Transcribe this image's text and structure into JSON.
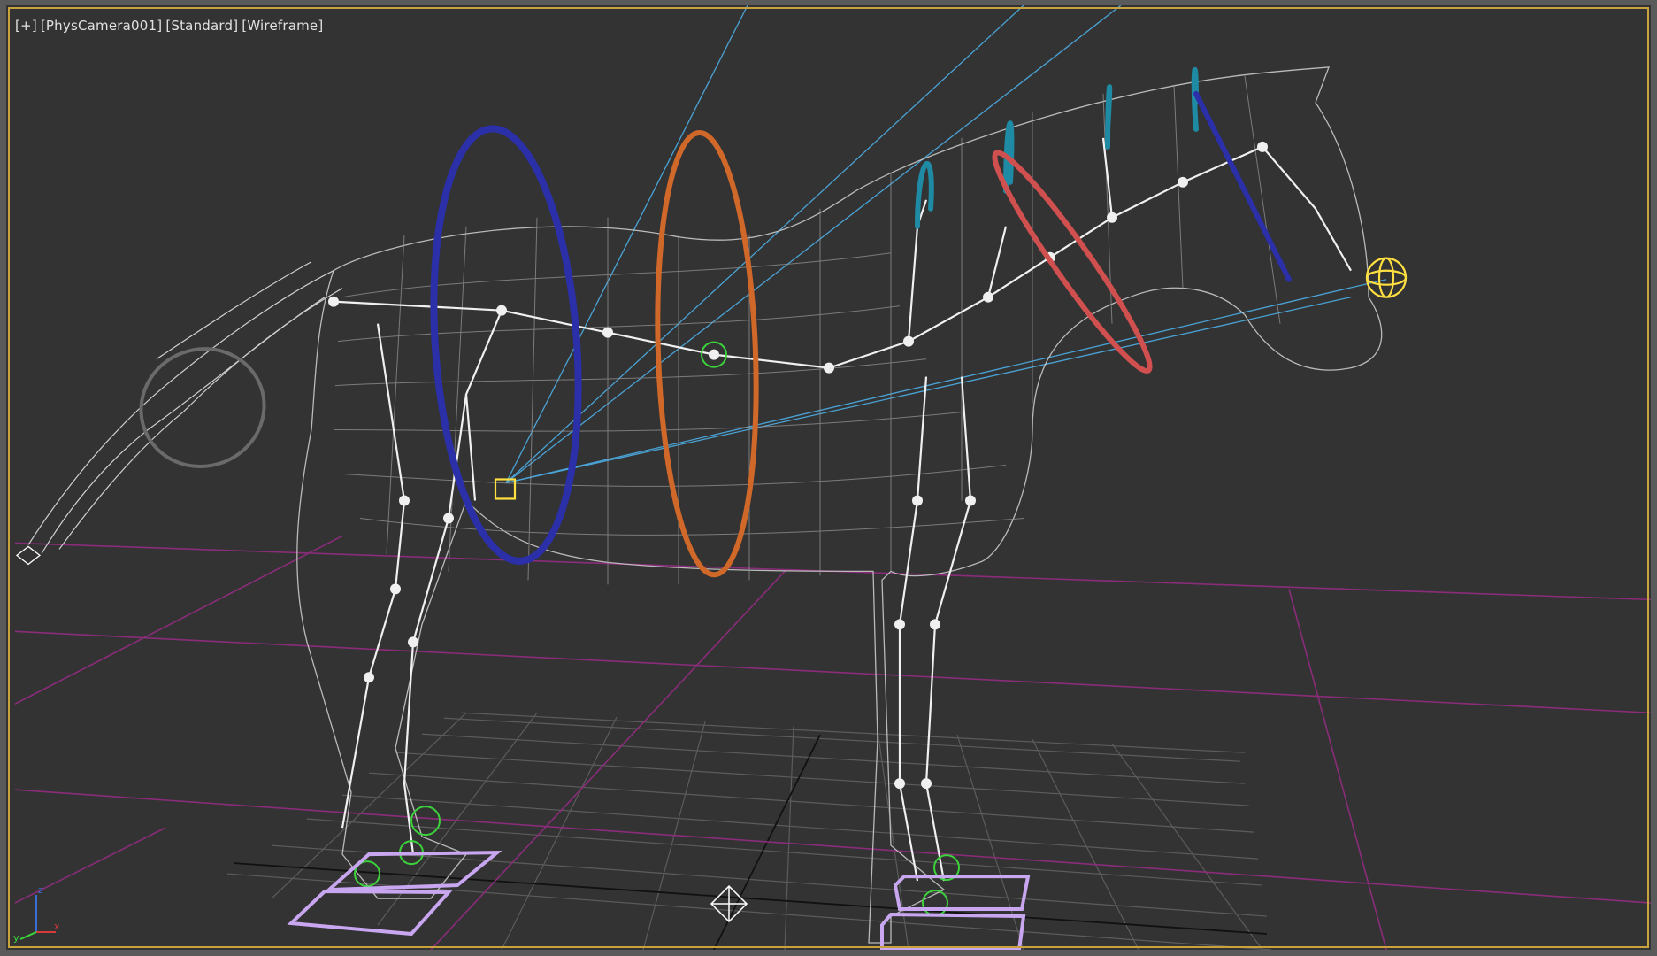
{
  "viewport": {
    "menus": [
      {
        "id": "general",
        "label": "[+]"
      },
      {
        "id": "camera",
        "label": "[PhysCamera001]"
      },
      {
        "id": "shading-mode",
        "label": "[Standard]"
      },
      {
        "id": "display-mode",
        "label": "[Wireframe]"
      }
    ],
    "axis_tripod": {
      "x_label": "x",
      "y_label": "y",
      "z_label": "z"
    }
  },
  "colors": {
    "background": "#333333",
    "active_border": "#c8a23c",
    "wireframe": "#c9c9c9",
    "grid_home": "#5c5c5c",
    "grid_lines_magenta": "#8a2c7a",
    "camera_rays": "#4aa3d6",
    "control_blue": "#2b2fa8",
    "control_orange": "#d0682a",
    "control_teal": "#1f8aa3",
    "control_red": "#d05050",
    "control_purple": "#c8a6f0",
    "control_green": "#3cd23c",
    "control_yellow": "#ffe040"
  },
  "icons": [
    "axis-tripod-icon",
    "camera-target-icon",
    "helper-point-icon"
  ]
}
